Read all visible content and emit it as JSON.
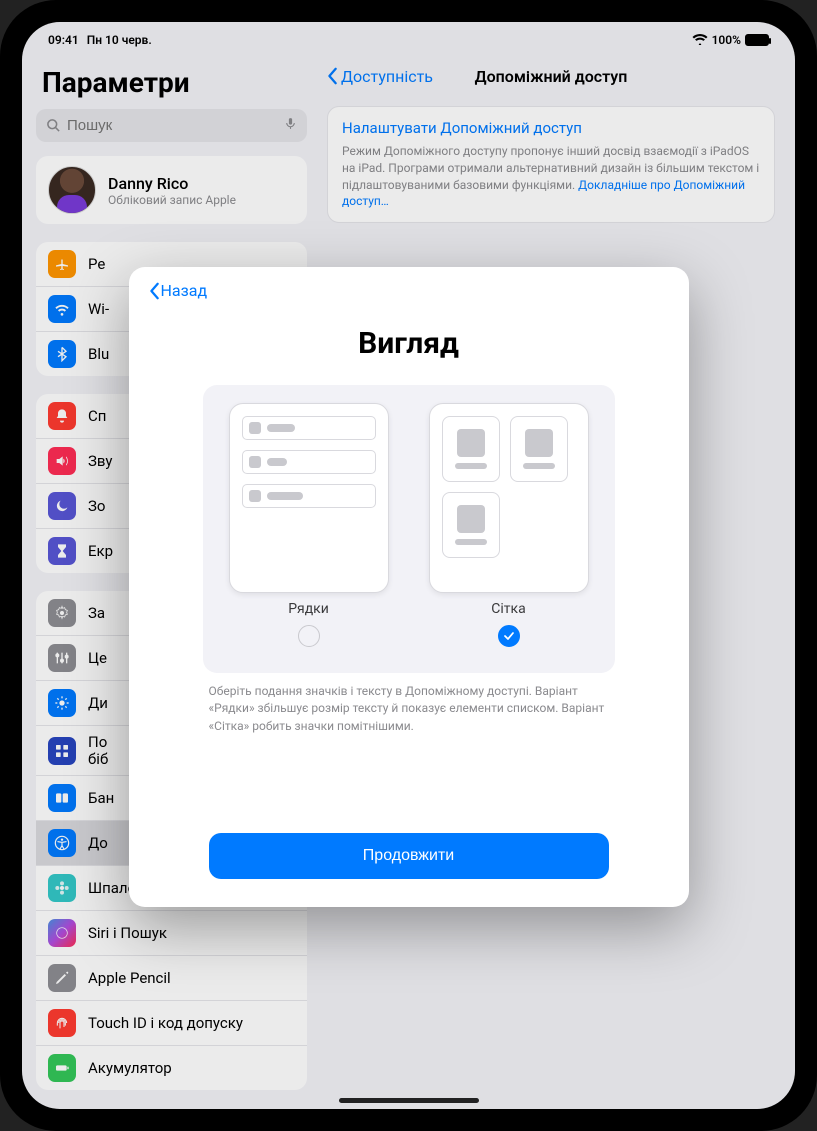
{
  "status": {
    "time": "09:41",
    "date": "Пн 10 черв.",
    "battery": "100%"
  },
  "sidebar": {
    "title": "Параметри",
    "search_placeholder": "Пошук",
    "user": {
      "name": "Danny Rico",
      "subtitle": "Обліковий запис Apple"
    },
    "group1": [
      "Ре",
      "Wi-",
      "Blu"
    ],
    "group2": [
      "Сп",
      "Зву",
      "Зо",
      "Екр"
    ],
    "group3": [
      "За",
      "Це",
      "Ди",
      "По\nбіб",
      "Бан",
      "До",
      "Шпалери",
      "Siri і Пошук",
      "Apple Pencil",
      "Touch ID і код допуску",
      "Акумулятор"
    ]
  },
  "detail": {
    "back": "Доступність",
    "title": "Допоміжний доступ",
    "card": {
      "link": "Налаштувати Допоміжний доступ",
      "desc": "Режим Допоміжного доступу пропонує інший досвід взаємодії з iPadOS на iPad. Програми отримали альтернативний дизайн із більшим текстом і підлаштовуваними базовими функціями.",
      "more": "Докладніше про Допоміжний доступ…"
    }
  },
  "sheet": {
    "back": "Назад",
    "title": "Вигляд",
    "option_rows": "Рядки",
    "option_grid": "Сітка",
    "selected": "grid",
    "hint": "Оберіть подання значків і тексту в Допоміжному доступі. Варіант «Рядки» збільшує розмір тексту й показує елементи списком. Варіант «Сітка» робить значки помітнішими.",
    "continue": "Продовжити"
  },
  "icons": {
    "colors": {
      "airplane": "#ff9500",
      "wifi": "#007aff",
      "bluetooth": "#007aff",
      "notifications": "#ff3b30",
      "sound": "#ff2d55",
      "focus": "#5856d6",
      "screentime": "#5856d6",
      "general": "#8e8e93",
      "control": "#8e8e93",
      "display": "#007aff",
      "homescreen": "#2845bf",
      "multitask": "#007aff",
      "accessibility": "#007aff",
      "wallpaper": "#34c8c8",
      "siri": "#1c1c1e",
      "pencil": "#8e8e93",
      "touchid": "#ff3b30",
      "battery": "#34c759"
    }
  }
}
